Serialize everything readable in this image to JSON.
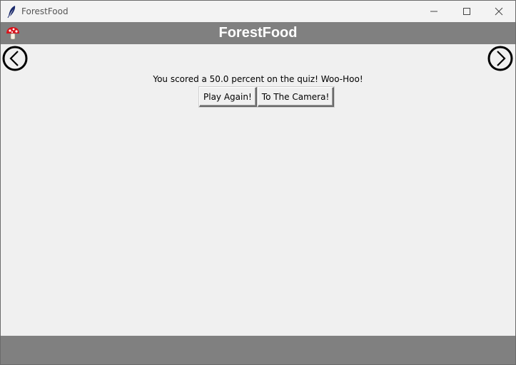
{
  "window": {
    "title": "ForestFood",
    "icons": {
      "app": "feather-icon",
      "minimize": "minimize-icon",
      "maximize": "maximize-icon",
      "close": "close-icon"
    }
  },
  "header": {
    "title": "ForestFood",
    "logo_icon": "mushroom-icon",
    "background": "#808080",
    "title_color": "#ffffff"
  },
  "navigation": {
    "back_icon": "chevron-left-circle-icon",
    "forward_icon": "chevron-right-circle-icon"
  },
  "result": {
    "message": "You scored a 50.0 percent on the quiz! Woo-Hoo!"
  },
  "actions": {
    "play_again_label": "Play Again!",
    "camera_label": "To The Camera!"
  },
  "colors": {
    "content_background": "#f0f0f0",
    "bar_gray": "#808080"
  }
}
